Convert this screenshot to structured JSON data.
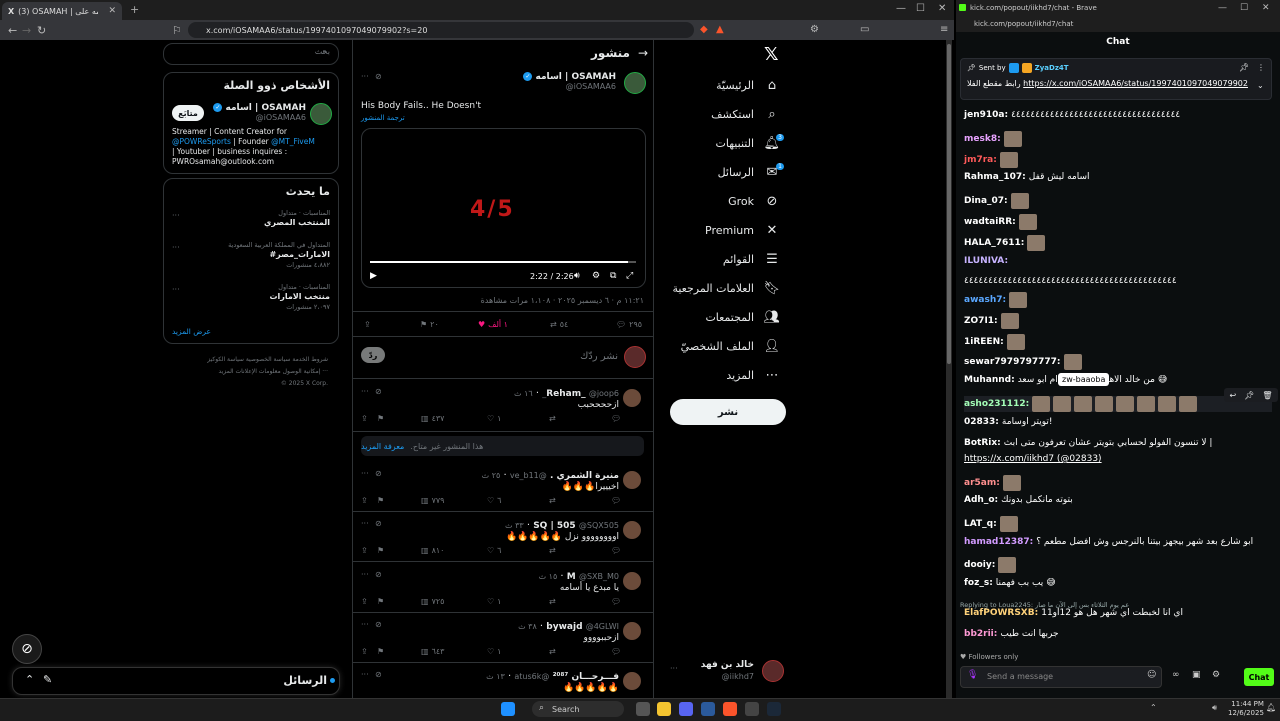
{
  "left_window": {
    "tab_title": "(3) OSAMAH | اسامه على X: \"Hi",
    "url": "x.com/iOSAMAA6/status/1997401097049079902?s=20"
  },
  "x_nav": {
    "items": [
      {
        "label": "الرئيسيّة",
        "icon": "home-icon",
        "glyph": "⌂"
      },
      {
        "label": "استكشف",
        "icon": "search-icon",
        "glyph": "⌕"
      },
      {
        "label": "التنبيهات",
        "icon": "bell-icon",
        "glyph": "🔔︎",
        "badge": "3"
      },
      {
        "label": "الرسائل",
        "icon": "mail-icon",
        "glyph": "✉",
        "badge": "1"
      },
      {
        "label": "Grok",
        "icon": "grok-icon",
        "glyph": "⊘"
      },
      {
        "label": "Premium",
        "icon": "x-icon",
        "glyph": "✕"
      },
      {
        "label": "القوائم",
        "icon": "list-icon",
        "glyph": "☰"
      },
      {
        "label": "العلامات المرجعية",
        "icon": "bookmark-icon",
        "glyph": "🔖︎"
      },
      {
        "label": "المجتمعات",
        "icon": "people-icon",
        "glyph": "👥︎"
      },
      {
        "label": "الملف الشخصيّ",
        "icon": "person-icon",
        "glyph": "👤︎"
      },
      {
        "label": "المزيد",
        "icon": "more-icon",
        "glyph": "⋯"
      }
    ],
    "post_button": "نشر",
    "account": {
      "name": "خالد بن فهد",
      "handle": "@iikhd7"
    }
  },
  "tweet": {
    "header_title": "منشور",
    "author_name": "اسامه | OSAMAH",
    "author_handle": "@iOSAMAA6",
    "text": "His Body Fails.. He Doesn't",
    "translate": "ترجمة المنشور",
    "video_overlay": "4/5",
    "video_time": "2:22 / 2:26",
    "video_progress": 0.97,
    "meta": "١١:٢١ م · ٦ ديسمبر ٢٠٢٥ · ١،١٠٨ مرات مشاهدة",
    "stats": {
      "replies": "٢٩٥",
      "reposts": "٥٤",
      "likes": "١ ألف",
      "bookmarks": "٢٠"
    },
    "reply_placeholder": "نشر ردّك",
    "reply_button": "ردّ"
  },
  "replies": [
    {
      "name": "Reham_",
      "handle": "@joop6_",
      "time": "١٦ ث",
      "text": "ازححححبب",
      "replies": "",
      "reposts": "",
      "likes": "١",
      "views": "٤٣٧"
    },
    {
      "name": "منيرة الشمري .",
      "handle": "@ve_b11",
      "time": "٢٥ ث",
      "text": "اخيييرا🔥🔥🔥",
      "replies": "",
      "reposts": "",
      "likes": "٦",
      "views": "٧٧٩"
    },
    {
      "name": "SQ | 505",
      "handle": "@SQX505",
      "time": "٣٣ ث",
      "text": "اوووووووو نزل 🔥🔥🔥🔥🔥",
      "replies": "",
      "reposts": "",
      "likes": "٦",
      "views": "٨١٠"
    },
    {
      "name": "M",
      "handle": "@SXB_M0",
      "time": "١٥ ث",
      "text": "يا مبدع يا أسامه",
      "replies": "",
      "reposts": "",
      "likes": "١",
      "views": "٧٢٥"
    },
    {
      "name": "bywajd",
      "handle": "@4GLWI",
      "time": "٣٨ ث",
      "text": "ازحببوووو",
      "replies": "",
      "reposts": "",
      "likes": "١",
      "views": "٦٤٣"
    },
    {
      "name": "فـــرحـــان ²⁰⁸⁷",
      "handle": "@atus6k",
      "time": "١٣ ث",
      "text": "🔥🔥🔥🔥🔥",
      "replies": "",
      "reposts": "",
      "likes": "",
      "views": ""
    }
  ],
  "unavailable_notice": {
    "text": "هذا المنشور غير متاح.",
    "link": "معرفة المزيد"
  },
  "sidebar": {
    "search_placeholder": "بحث",
    "related_title": "الأشخاص ذوو الصلة",
    "related_name": "اسامه | OSAMAH",
    "related_handle": "@iOSAMAA6",
    "related_follow": "متابَع",
    "related_bio_1": "Streamer | Content Creator for",
    "related_bio_2a": "@POWReSports",
    "related_bio_2b": " | Founder ",
    "related_bio_2c": "@MT_FiveM",
    "related_bio_3": "| Youtuber | business inquires :",
    "related_bio_4": "PWROsamah@outlook.com",
    "trending_title": "ما يحدث",
    "trends": [
      {
        "context": "المناسبات · متداول",
        "title": "المنتخب المصري",
        "count": ""
      },
      {
        "context": "المتداول في المملكة العربية السعودية",
        "title": "#الامارات_مصر",
        "count": "٤،٨٨٢ منشورات"
      },
      {
        "context": "المناسبات · متداول",
        "title": "منتخب الامارات",
        "count": "٢،٠٩٧ منشورات"
      }
    ],
    "show_more": "عرض المزيد",
    "footer_1": "شروط الخدمة   سياسة الخصوصية   سياسة الكوكيز",
    "footer_2": "إمكانية الوصول   معلومات الإعلانات   المزيد ···",
    "footer_3": "© 2025 X Corp.",
    "messages_label": "الرسائل"
  },
  "kick": {
    "title_bar": "kick.com/popout/iikhd7/chat - Brave",
    "url": "kick.com/popout/iikhd7/chat",
    "header": "Chat",
    "pinned_sender_label": "Sent by",
    "pinned_sender": "ZyaDz4T",
    "pinned_text": "رابط مقطع الفلا",
    "pinned_link": "https://x.com/iOSAMAA6/status/1997401097049079902",
    "messages": [
      {
        "user": "jen910a:",
        "color": "#ffffff",
        "text": "٤٤٤٤٤٤٤٤٤٤٤٤٤٤٤٤٤٤٤٤٤٤٤٤٤٤٤٤٤٤٤٤٤٤٤"
      },
      {
        "user": "mesk8:",
        "color": "#e8a3ff",
        "text": ""
      },
      {
        "user": "jm7ra:",
        "color": "#ff5a5a",
        "text": ""
      },
      {
        "user": "Rahma_107:",
        "color": "#ffffff",
        "text": "اسامه ليش قفل"
      },
      {
        "user": "Dina_07:",
        "color": "#ffffff",
        "text": ""
      },
      {
        "user": "wadtaiRR:",
        "color": "#ffffff",
        "text": ""
      },
      {
        "user": "HALA_7611:",
        "color": "#ffffff",
        "text": ""
      },
      {
        "user": "ILUNIVA:",
        "color": "#c7b3ff",
        "text": ""
      },
      {
        "user": "",
        "color": "#ffffff",
        "text": "٤٤٤٤٤٤٤٤٤٤٤٤٤٤٤٤٤٤٤٤٤٤٤٤٤٤٤٤٤٤٤٤٤٤٤٤٤٤٤٤٤٤٤٤"
      },
      {
        "user": "awash7:",
        "color": "#5aa7ff",
        "text": ""
      },
      {
        "user": "ZO7I1:",
        "color": "#ffffff",
        "text": ""
      },
      {
        "user": "1iREEN:",
        "color": "#ffffff",
        "text": ""
      },
      {
        "user": "sewar7979797777:",
        "color": "#ffffff",
        "text": ""
      },
      {
        "user": "Muhannd:",
        "color": "#ffffff",
        "text": "من خالد الاهلي بيرجع الكدام ابو سعد 😅"
      },
      {
        "user": "asho231112:",
        "color": "#a4ffb7",
        "text": ""
      },
      {
        "user": "02833:",
        "color": "#ffffff",
        "text": "تويتر اوسامة!"
      },
      {
        "user": "BotRix:",
        "color": "#ffffff",
        "text": "لا تنسون الفولو لحسابي بتويتر عشان تعرفون متى ابث |"
      },
      {
        "user": "",
        "color": "#ffffff",
        "text": "https://x.com/iikhd7 (@02833)"
      },
      {
        "user": "ar5am:",
        "color": "#ff8f8f",
        "text": ""
      },
      {
        "user": "Adh_o:",
        "color": "#ffffff",
        "text": "بتوته مانكمل بدونك"
      },
      {
        "user": "LAT_q:",
        "color": "#ffffff",
        "text": ""
      },
      {
        "user": "hamad12387:",
        "color": "#d29bff",
        "text": "ابو شارع بعد شهر بيجهز بيتنا بالنرجس وش افضل مطعم ؟"
      },
      {
        "user": "dooiy:",
        "color": "#ffffff",
        "text": ""
      },
      {
        "user": "foz_s:",
        "color": "#ffffff",
        "text": "يب بب فهمنا 😅"
      },
      {
        "user": "ElafPOWRSXB:",
        "color": "#ffd27a",
        "text": "اي أنا لخبطت اي شهر هل هو 12او11"
      },
      {
        "user": "bb2rii:",
        "color": "#ff9ad5",
        "text": "جربها انت طيب"
      }
    ],
    "replying_to": "Replying to Loua2245: عم يوم الثلاثاء بس إلى الآن ما صار",
    "tooltip": "zw-baaoba",
    "followers_only": "Followers only",
    "input_placeholder": "Send a message",
    "chat_button": "Chat"
  },
  "taskbar": {
    "search": "Search",
    "time": "11:44 PM",
    "date": "12/6/2025"
  }
}
